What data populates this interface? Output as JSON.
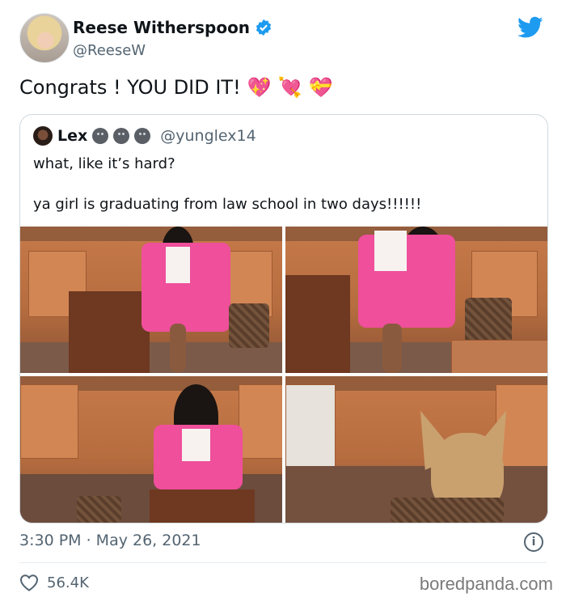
{
  "author": {
    "name": "Reese Witherspoon",
    "handle": "@ReeseW",
    "verified": true
  },
  "tweet": {
    "text": "Congrats ! YOU DID IT!",
    "emojis": [
      "💖",
      "💘",
      "💝"
    ]
  },
  "quoted": {
    "name": "Lex",
    "handle": "@yunglex14",
    "line1": "what, like it’s hard?",
    "line2": "ya girl is graduating from law school in two days!!!!!!"
  },
  "footer": {
    "time": "3:30 PM · May 26, 2021",
    "likes": "56.4K",
    "watermark": "boredpanda.com"
  },
  "colors": {
    "twitter_blue": "#1d9bf0",
    "muted": "#536471",
    "pink_suit": "#ef4f9b"
  }
}
